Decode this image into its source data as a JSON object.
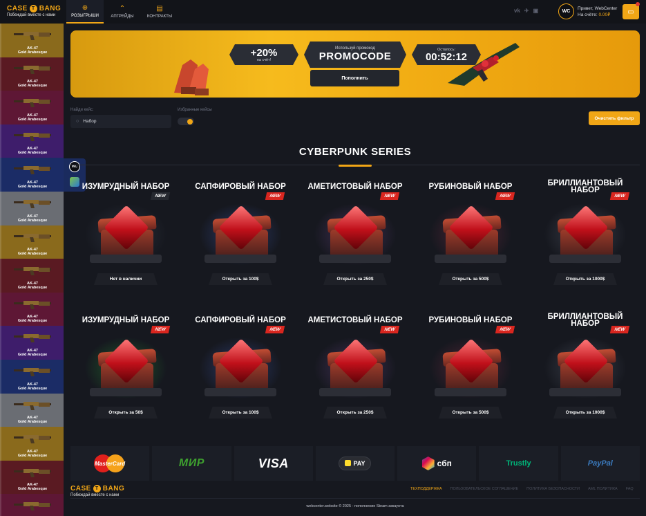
{
  "header": {
    "logo_left": "CASE",
    "logo_coin": "T",
    "logo_right": "BANG",
    "logo_tagline": "Побеждай вместе с нами",
    "nav": [
      {
        "label": "РОЗЫГРЫШИ",
        "icon": "gift-icon"
      },
      {
        "label": "АПГРЕЙДЫ",
        "icon": "upgrade-icon"
      },
      {
        "label": "КОНТРАКТЫ",
        "icon": "contract-icon"
      }
    ],
    "socials": [
      "vk-icon",
      "telegram-icon",
      "twitch-icon"
    ],
    "social_glyphs": [
      "vk",
      "✈",
      "▣"
    ],
    "avatar_initials": "WC",
    "greeting_prefix": "Привет, ",
    "username": "WebCenter",
    "balance_label": "На счёте: ",
    "balance_value": "0.00₽"
  },
  "live_drops": {
    "items": [
      {
        "name": "AK-47",
        "skin": "Gold Arabesque",
        "color": "#8a6a1c"
      },
      {
        "name": "AK-47",
        "skin": "Gold Arabesque",
        "color": "#5a1a22"
      },
      {
        "name": "AK-47",
        "skin": "Gold Arabesque",
        "color": "#5e1735"
      },
      {
        "name": "AK-47",
        "skin": "Gold Arabesque",
        "color": "#3e1d6b"
      },
      {
        "name": "AK-47",
        "skin": "Gold Arabesque",
        "color": "#1b2c66"
      },
      {
        "name": "AK-47",
        "skin": "Gold Arabesque",
        "color": "#6a6d73"
      },
      {
        "name": "AK-47",
        "skin": "Gold Arabesque",
        "color": "#8a6a1c"
      },
      {
        "name": "AK-47",
        "skin": "Gold Arabesque",
        "color": "#5a1a22"
      },
      {
        "name": "AK-47",
        "skin": "Gold Arabesque",
        "color": "#5e1735"
      },
      {
        "name": "AK-47",
        "skin": "Gold Arabesque",
        "color": "#3e1d6b"
      },
      {
        "name": "AK-47",
        "skin": "Gold Arabesque",
        "color": "#1b2c66"
      },
      {
        "name": "AK-47",
        "skin": "Gold Arabesque",
        "color": "#6a6d73"
      },
      {
        "name": "AK-47",
        "skin": "Gold Arabesque",
        "color": "#8a6a1c"
      },
      {
        "name": "AK-47",
        "skin": "Gold Arabesque",
        "color": "#5a1a22"
      },
      {
        "name": "AK-47",
        "skin": "Gold Arabesque",
        "color": "#5e1735"
      }
    ],
    "hover_card": {
      "avatar_initials": "WC"
    }
  },
  "banner": {
    "bonus": "+20%",
    "bonus_note": "на счёт!",
    "promo_caption": "Используй промокод",
    "promo_code": "PROMOCODE",
    "topup_button": "Пополнить",
    "timer_caption": "Осталось:",
    "timer_value": "00:52:12"
  },
  "filters": {
    "search_label": "Найди кейс:",
    "search_value": "Набор",
    "favorites_label": "Избранные кейсы",
    "favorites_on": true,
    "clear_button": "Очистить фильтр"
  },
  "section": {
    "title": "CYBERPUNK SERIES",
    "badge_new": "NEW",
    "cases": [
      {
        "title": "ИЗУМРУДНЫЙ НАБОР",
        "button": "Нет в наличии",
        "badge_color": "#262930",
        "glow": "#2a2f3a"
      },
      {
        "title": "САПФИРОВЫЙ НАБОР",
        "button": "Открыть за 100$",
        "badge_color": "#d9261f",
        "glow": "#2b3a6a"
      },
      {
        "title": "АМЕТИСТОВЫЙ НАБОР",
        "button": "Открыть за 250$",
        "badge_color": "#d9261f",
        "glow": "#433057"
      },
      {
        "title": "РУБИНОВЫЙ НАБОР",
        "button": "Открыть за 500$",
        "badge_color": "#d9261f",
        "glow": "#4f2435"
      },
      {
        "title": "БРИЛЛИАНТОВЫЙ НАБОР",
        "button": "Открыть за 1000$",
        "badge_color": "#d9261f",
        "glow": "#3b3f4a"
      },
      {
        "title": "ИЗУМРУДНЫЙ НАБОР",
        "button": "Открыть за 50$",
        "badge_color": "#d9261f",
        "glow": "#1f5a2a"
      },
      {
        "title": "САПФИРОВЫЙ НАБОР",
        "button": "Открыть за 100$",
        "badge_color": "#d9261f",
        "glow": "#2b3a6a"
      },
      {
        "title": "АМЕТИСТОВЫЙ НАБОР",
        "button": "Открыть за 250$",
        "badge_color": "#d9261f",
        "glow": "#433057"
      },
      {
        "title": "РУБИНОВЫЙ НАБОР",
        "button": "Открыть за 500$",
        "badge_color": "#d9261f",
        "glow": "#4f2435"
      },
      {
        "title": "БРИЛЛИАНТОВЫЙ НАБОР",
        "button": "Открыть за 1000$",
        "badge_color": "#d9261f",
        "glow": "#3b3f4a"
      }
    ]
  },
  "payments": {
    "methods": [
      {
        "id": "mc",
        "label": "MasterCard"
      },
      {
        "id": "mir",
        "label": "МИР"
      },
      {
        "id": "visa",
        "label": "VISA"
      },
      {
        "id": "tpay",
        "label": "PAY"
      },
      {
        "id": "sbp",
        "label": "сбп"
      },
      {
        "id": "trusty",
        "label": "Trustly"
      },
      {
        "id": "paypal",
        "label": "PayPal"
      }
    ]
  },
  "footer": {
    "logo_left": "CASE",
    "logo_coin": "T",
    "logo_right": "BANG",
    "tagline": "Побеждай вместе с нами",
    "links": [
      "ТЕХПОДДЕРЖКА",
      "ПОЛЬЗОВАТЕЛЬСКОЕ СОГЛАШЕНИЕ",
      "ПОЛИТИКА БЕЗОПАСНОСТИ",
      "AML ПОЛИТИКА",
      "FAQ"
    ],
    "copyright": "webcenter.website © 2025 - пополнение Steam аккаунта"
  },
  "colors": {
    "accent": "#f1a616",
    "new_badge": "#d9261f",
    "background": "#16181f"
  }
}
